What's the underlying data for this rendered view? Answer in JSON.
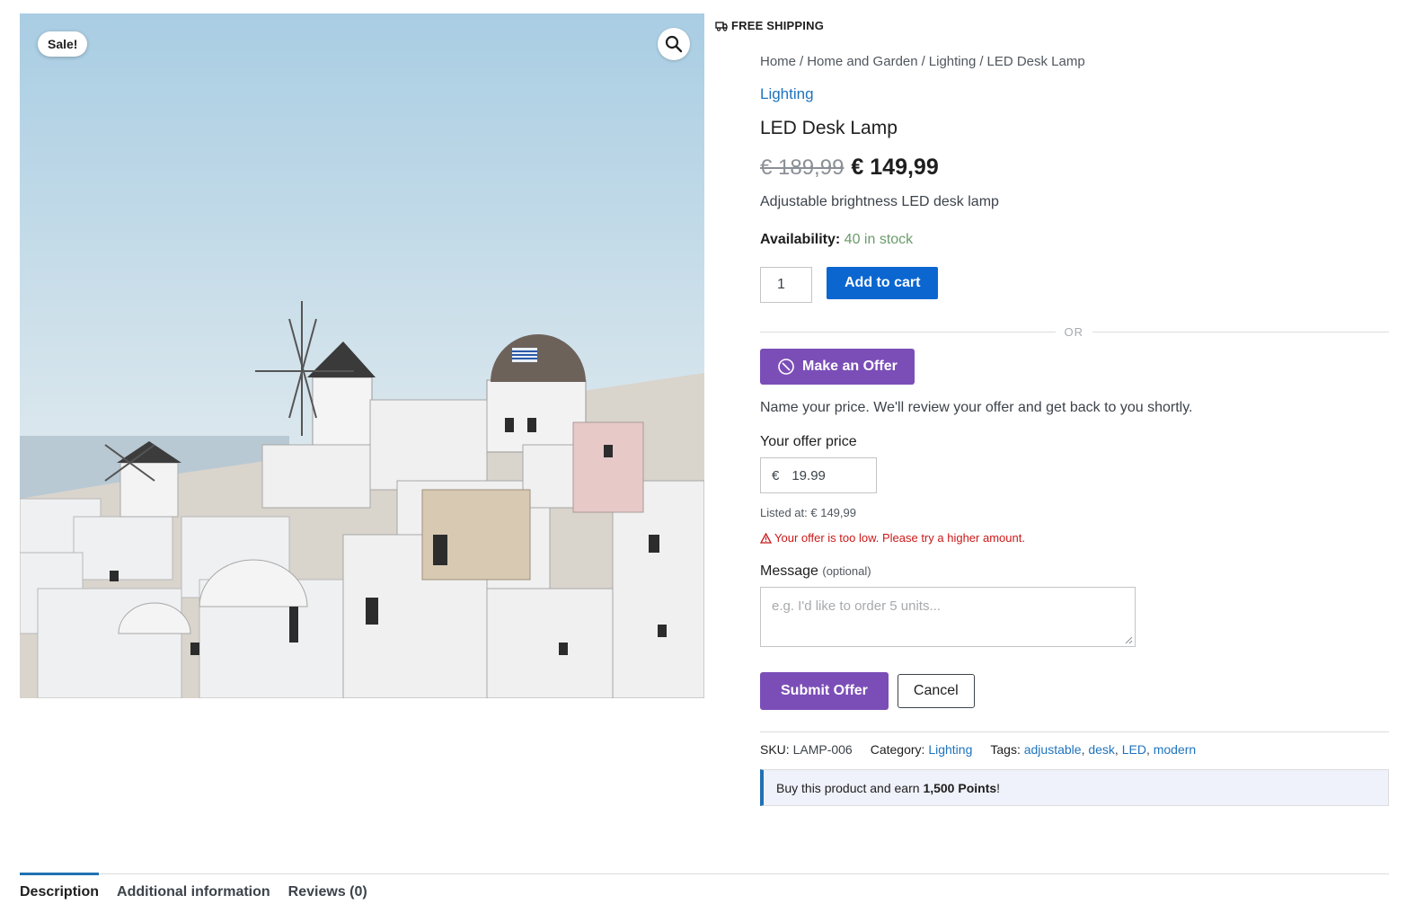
{
  "gallery": {
    "sale_badge": "Sale!",
    "zoom_icon": "magnifier-icon",
    "image_subject": "santorini-windmills-photo"
  },
  "shipping": {
    "icon": "truck-icon",
    "label": "FREE SHIPPING"
  },
  "breadcrumb": {
    "items": [
      "Home",
      "Home and Garden",
      "Lighting",
      "LED Desk Lamp"
    ],
    "separator": "/"
  },
  "product": {
    "category_link": "Lighting",
    "title": "LED Desk Lamp",
    "price_old": "€ 189,99",
    "price_new": "€ 149,99",
    "short_description": "Adjustable brightness LED desk lamp",
    "availability_label": "Availability:",
    "availability_value": "40 in stock"
  },
  "cart": {
    "quantity": "1",
    "add_to_cart_label": "Add to cart"
  },
  "offer": {
    "divider_label": "OR",
    "make_offer_label": "Make an Offer",
    "make_offer_icon": "tag-circle-icon",
    "note": "Name your price. We'll review your offer and get back to you shortly.",
    "price_label": "Your offer price",
    "currency": "€",
    "price_value": "19.99",
    "listed_at": "Listed at: € 149,99",
    "error_icon": "warning-icon",
    "error": "Your offer is too low. Please try a higher amount.",
    "message_label": "Message",
    "message_optional": "(optional)",
    "message_placeholder": "e.g. I'd like to order 5 units...",
    "submit_label": "Submit Offer",
    "cancel_label": "Cancel"
  },
  "meta": {
    "sku_label": "SKU:",
    "sku_value": "LAMP-006",
    "category_label": "Category:",
    "category_value": "Lighting",
    "tags_label": "Tags:",
    "tags": [
      "adjustable",
      "desk",
      "LED",
      "modern"
    ]
  },
  "points": {
    "prefix": "Buy this product and earn ",
    "amount": "1,500 Points",
    "suffix": "!"
  },
  "tabs": [
    {
      "label": "Description",
      "active": true
    },
    {
      "label": "Additional information",
      "active": false
    },
    {
      "label": "Reviews (0)",
      "active": false
    }
  ],
  "colors": {
    "accent_blue": "#0b66d0",
    "link_blue": "#1e73be",
    "offer_purple": "#7b4eb7",
    "error_red": "#cc1818",
    "stock_green": "#6b9b6b"
  }
}
